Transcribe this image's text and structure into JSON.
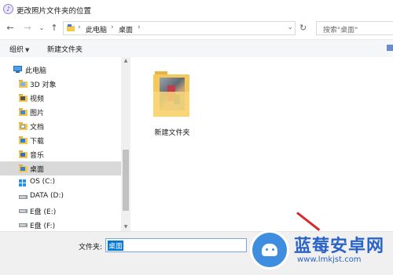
{
  "window": {
    "title": "更改照片文件夹的位置"
  },
  "address": {
    "crumbs": [
      "此电脑",
      "桌面"
    ],
    "search_placeholder": "搜索\"桌面\""
  },
  "toolbar": {
    "organize": "组织",
    "new_folder": "新建文件夹"
  },
  "nav": {
    "items": [
      {
        "label": "此电脑",
        "icon": "pc-icon"
      },
      {
        "label": "3D 对象",
        "icon": "folder-3d-icon"
      },
      {
        "label": "视频",
        "icon": "folder-video-icon"
      },
      {
        "label": "图片",
        "icon": "folder-pictures-icon"
      },
      {
        "label": "文档",
        "icon": "folder-documents-icon"
      },
      {
        "label": "下载",
        "icon": "folder-downloads-icon"
      },
      {
        "label": "音乐",
        "icon": "folder-music-icon"
      },
      {
        "label": "桌面",
        "icon": "folder-desktop-icon",
        "selected": true
      },
      {
        "label": "OS (C:)",
        "icon": "windows-drive-icon"
      },
      {
        "label": "DATA (D:)",
        "icon": "drive-icon"
      },
      {
        "label": "E盘 (E:)",
        "icon": "drive-icon"
      },
      {
        "label": "E盘 (F:)",
        "icon": "drive-icon"
      }
    ]
  },
  "content": {
    "items": [
      {
        "name": "新建文件夹",
        "icon": "folder-with-photo-icon"
      }
    ]
  },
  "bottom": {
    "filename_label": "文件夹:",
    "filename_value": "桌面"
  },
  "watermark": {
    "title": "蓝莓安卓网",
    "url": "www.lmkjst.com"
  },
  "colors": {
    "selection": "#d9d9d9",
    "input_highlight": "#0078d7",
    "watermark_blue": "#2a63c8",
    "annotation_red": "#d6282f"
  }
}
